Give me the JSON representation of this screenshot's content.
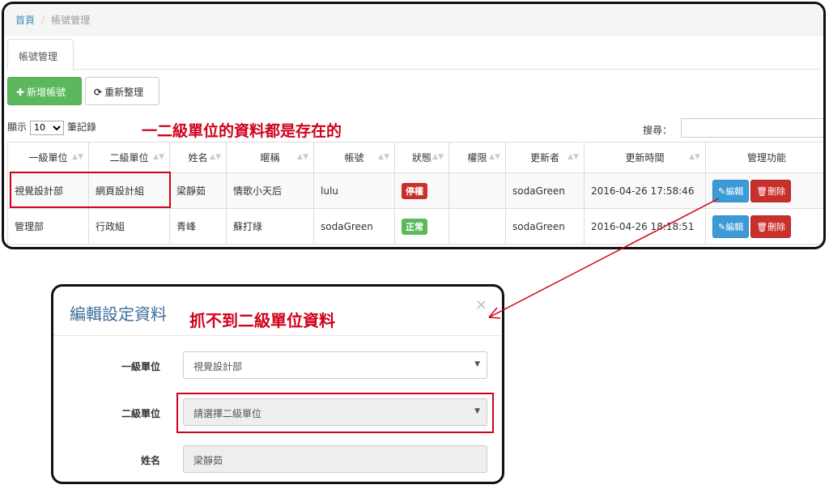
{
  "breadcrumb": {
    "home": "首頁",
    "separator": "/",
    "current": "帳號管理"
  },
  "tab": {
    "label": "帳號管理"
  },
  "toolbar": {
    "add_label": "新增帳號",
    "refresh_label": "重新整理"
  },
  "length": {
    "prefix": "顯示",
    "value": "10",
    "suffix": "筆記錄"
  },
  "search": {
    "label": "搜尋：",
    "value": ""
  },
  "annotation1": "一二級單位的資料都是存在的",
  "table": {
    "headers": [
      "一級單位",
      "二級單位",
      "姓名",
      "暱稱",
      "帳號",
      "狀態",
      "權限",
      "更新者",
      "更新時間",
      "管理功能"
    ],
    "rows": [
      {
        "unit1": "視覺設計部",
        "unit2": "網頁設計組",
        "name": "梁靜茹",
        "nickname": "情歌小天后",
        "account": "lulu",
        "status": "停權",
        "permission": "",
        "updater": "sodaGreen",
        "updated": "2016-04-26 17:58:46",
        "edit": "編輯",
        "delete": "刪除"
      },
      {
        "unit1": "管理部",
        "unit2": "行政組",
        "name": "青峰",
        "nickname": "蘇打綠",
        "account": "sodaGreen",
        "status": "正常",
        "permission": "",
        "updater": "sodaGreen",
        "updated": "2016-04-26 18:18:51",
        "edit": "編輯",
        "delete": "刪除"
      }
    ]
  },
  "status_colors": {
    "suspended": "#c9302c",
    "normal": "#5cb85c"
  },
  "modal": {
    "title": "編輯設定資料",
    "close": "×",
    "annotation2": "抓不到二級單位資料",
    "field1_label": "一級單位",
    "field1_value": "視覺設計部",
    "field2_label": "二級單位",
    "field2_value": "請選擇二級單位",
    "field3_label": "姓名",
    "field3_value": "梁靜茹"
  },
  "icons": {
    "add": "plus-icon",
    "refresh": "refresh-icon",
    "edit": "pencil-icon",
    "delete": "trash-icon",
    "sort": "sort-icon",
    "caret": "caret-down-icon"
  }
}
